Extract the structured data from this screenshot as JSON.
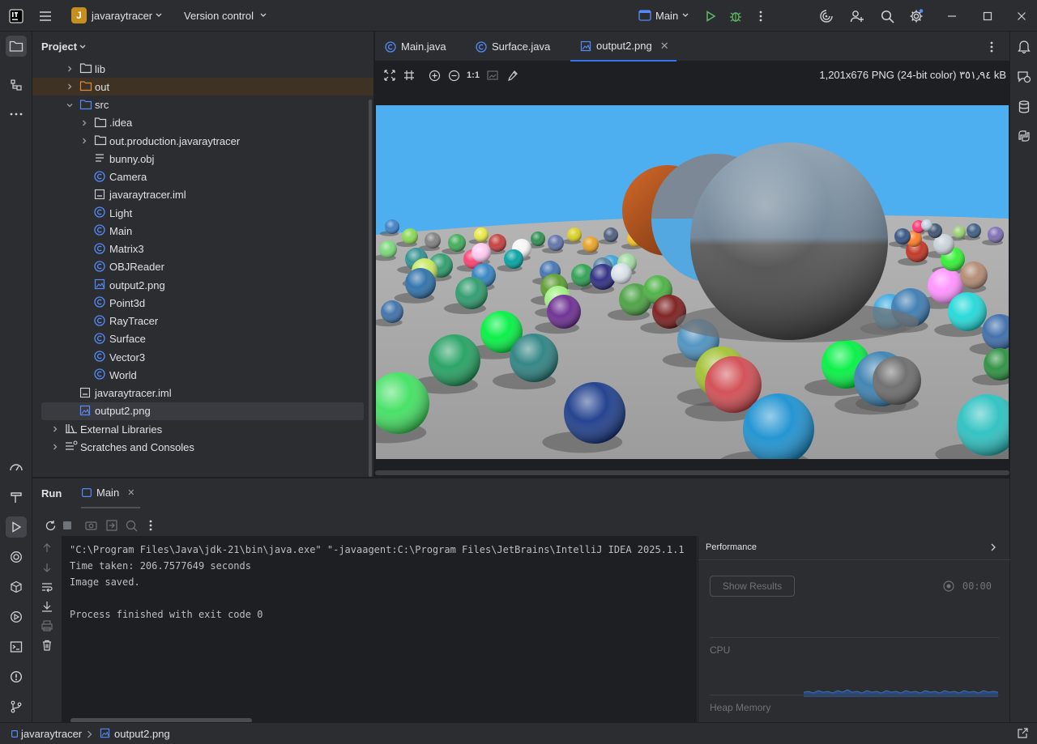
{
  "titlebar": {
    "project_badge": "J",
    "project_name": "javaraytracer",
    "version_control": "Version control",
    "run_config": "Main"
  },
  "left_stripe": {
    "icons": [
      "project-icon",
      "structure-icon",
      "more-icon",
      "profiler-icon",
      "build-icon",
      "run-icon",
      "services-icon",
      "packages-icon",
      "debug-icon",
      "terminal-icon",
      "problems-icon",
      "git-icon"
    ]
  },
  "project_panel": {
    "title": "Project",
    "rows": [
      {
        "label": "lib",
        "type": "folder",
        "depth": 2,
        "expanded": false
      },
      {
        "label": "out",
        "type": "folder-excluded",
        "depth": 2,
        "expanded": false
      },
      {
        "label": "src",
        "type": "folder-src",
        "depth": 2,
        "expanded": true
      },
      {
        "label": ".idea",
        "type": "folder",
        "depth": 3,
        "expanded": false
      },
      {
        "label": "out.production.javaraytracer",
        "type": "folder",
        "depth": 3,
        "expanded": false
      },
      {
        "label": "bunny.obj",
        "type": "text",
        "depth": 3
      },
      {
        "label": "Camera",
        "type": "class",
        "depth": 3
      },
      {
        "label": "javaraytracer.iml",
        "type": "iml",
        "depth": 3
      },
      {
        "label": "Light",
        "type": "class",
        "depth": 3
      },
      {
        "label": "Main",
        "type": "class",
        "depth": 3
      },
      {
        "label": "Matrix3",
        "type": "class",
        "depth": 3
      },
      {
        "label": "OBJReader",
        "type": "class",
        "depth": 3
      },
      {
        "label": "output2.png",
        "type": "image",
        "depth": 3
      },
      {
        "label": "Point3d",
        "type": "class",
        "depth": 3
      },
      {
        "label": "RayTracer",
        "type": "class",
        "depth": 3
      },
      {
        "label": "Surface",
        "type": "class",
        "depth": 3
      },
      {
        "label": "Vector3",
        "type": "class",
        "depth": 3
      },
      {
        "label": "World",
        "type": "class",
        "depth": 3
      },
      {
        "label": "javaraytracer.iml",
        "type": "iml",
        "depth": 2
      },
      {
        "label": "output2.png",
        "type": "image",
        "depth": 2
      },
      {
        "label": "External Libraries",
        "type": "libraries",
        "depth": 1,
        "expanded": false
      },
      {
        "label": "Scratches and Consoles",
        "type": "scratches",
        "depth": 1,
        "expanded": false
      }
    ]
  },
  "editor": {
    "tabs": [
      {
        "label": "Main.java",
        "type": "class"
      },
      {
        "label": "Surface.java",
        "type": "class"
      },
      {
        "label": "output2.png",
        "type": "image",
        "active": true
      }
    ],
    "zoom_actual": "1:1",
    "image_info": "1,201x676 PNG (24-bit color) ٣٥١٫٩٤ kB"
  },
  "run_panel": {
    "title": "Run",
    "tab": "Main",
    "console_lines": [
      "\"C:\\Program Files\\Java\\jdk-21\\bin\\java.exe\" \"-javaagent:C:\\Program Files\\JetBrains\\IntelliJ IDEA 2025.1.1",
      "Time taken: 206.7577649 seconds",
      "Image saved.",
      "",
      "Process finished with exit code 0"
    ],
    "performance": {
      "title": "Performance",
      "show_results": "Show Results",
      "timer": "00:00",
      "cpu_label": "CPU",
      "heap_label": "Heap Memory"
    }
  },
  "statusbar": {
    "project": "javaraytracer",
    "file": "output2.png"
  },
  "colors": {
    "accent": "#3574f0",
    "sky": "#4daef0",
    "floor": "#a8a8a8",
    "badge": "#c68e1c"
  }
}
